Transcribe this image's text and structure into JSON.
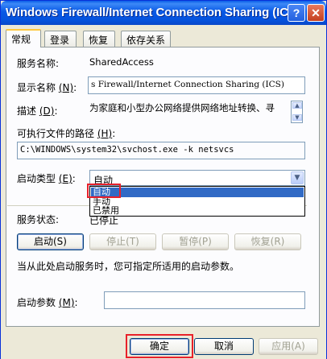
{
  "window": {
    "title": "Windows Firewall/Internet Connection Sharing (ICS)",
    "help_glyph": "?",
    "close_glyph": "✕"
  },
  "tabs": [
    {
      "label": "常规",
      "active": true
    },
    {
      "label": "登录"
    },
    {
      "label": "恢复"
    },
    {
      "label": "依存关系"
    }
  ],
  "general": {
    "service_name_label": "服务名称:",
    "service_name_value": "SharedAccess",
    "display_name_label": "显示名称 ",
    "display_name_key": "(N)",
    "display_name_colon": ":",
    "display_name_value": "s Firewall/Internet Connection Sharing (ICS)",
    "description_label": "描述 ",
    "description_key": "(D)",
    "description_colon": ":",
    "description_value": "为家庭和小型办公网络提供网络地址转换、寻",
    "exe_path_label": "可执行文件的路径 ",
    "exe_path_key": "(H)",
    "exe_path_colon": ":",
    "exe_path_value": "C:\\WINDOWS\\system32\\svchost.exe -k netsvcs",
    "startup_type_label": "启动类型 ",
    "startup_type_key": "(E)",
    "startup_type_colon": ":",
    "startup_type_value": "自动",
    "startup_type_options": [
      "自动",
      "手动",
      "已禁用"
    ],
    "service_status_label": "服务状态:",
    "service_status_value": "已停止",
    "buttons": {
      "start": "启动(S)",
      "stop": "停止(T)",
      "pause": "暂停(P)",
      "resume": "恢复(R)"
    },
    "hint": "当从此处启动服务时，您可指定所适用的启动参数。",
    "start_params_label": "启动参数 ",
    "start_params_key": "(M)",
    "start_params_colon": ":",
    "start_params_value": ""
  },
  "footer": {
    "ok": "确定",
    "cancel": "取消",
    "apply": "应用(A)"
  },
  "colors": {
    "highlight_red": "#e8212b",
    "selection_blue": "#316ac5",
    "title_blue": "#0858e6"
  }
}
